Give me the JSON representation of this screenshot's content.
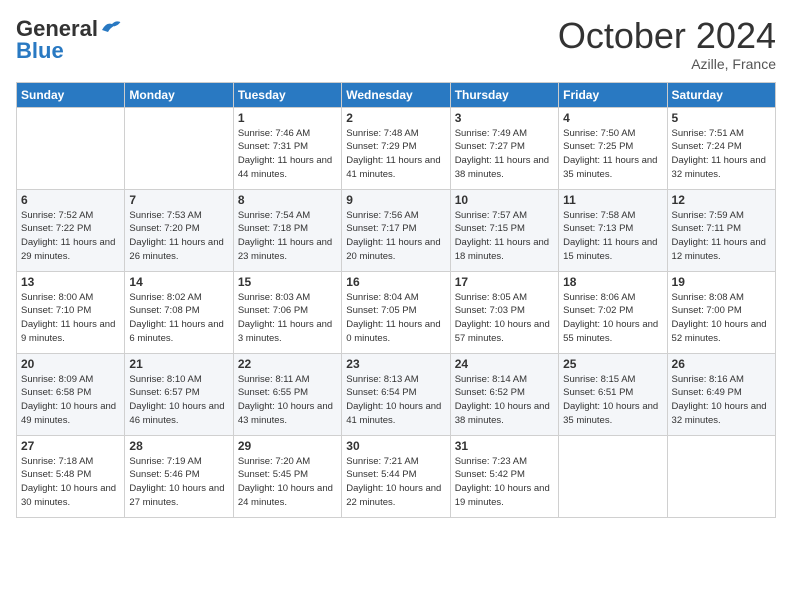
{
  "header": {
    "logo_general": "General",
    "logo_blue": "Blue",
    "month_title": "October 2024",
    "subtitle": "Azille, France"
  },
  "weekdays": [
    "Sunday",
    "Monday",
    "Tuesday",
    "Wednesday",
    "Thursday",
    "Friday",
    "Saturday"
  ],
  "weeks": [
    [
      {
        "day": "",
        "sunrise": "",
        "sunset": "",
        "daylight": ""
      },
      {
        "day": "",
        "sunrise": "",
        "sunset": "",
        "daylight": ""
      },
      {
        "day": "1",
        "sunrise": "Sunrise: 7:46 AM",
        "sunset": "Sunset: 7:31 PM",
        "daylight": "Daylight: 11 hours and 44 minutes."
      },
      {
        "day": "2",
        "sunrise": "Sunrise: 7:48 AM",
        "sunset": "Sunset: 7:29 PM",
        "daylight": "Daylight: 11 hours and 41 minutes."
      },
      {
        "day": "3",
        "sunrise": "Sunrise: 7:49 AM",
        "sunset": "Sunset: 7:27 PM",
        "daylight": "Daylight: 11 hours and 38 minutes."
      },
      {
        "day": "4",
        "sunrise": "Sunrise: 7:50 AM",
        "sunset": "Sunset: 7:25 PM",
        "daylight": "Daylight: 11 hours and 35 minutes."
      },
      {
        "day": "5",
        "sunrise": "Sunrise: 7:51 AM",
        "sunset": "Sunset: 7:24 PM",
        "daylight": "Daylight: 11 hours and 32 minutes."
      }
    ],
    [
      {
        "day": "6",
        "sunrise": "Sunrise: 7:52 AM",
        "sunset": "Sunset: 7:22 PM",
        "daylight": "Daylight: 11 hours and 29 minutes."
      },
      {
        "day": "7",
        "sunrise": "Sunrise: 7:53 AM",
        "sunset": "Sunset: 7:20 PM",
        "daylight": "Daylight: 11 hours and 26 minutes."
      },
      {
        "day": "8",
        "sunrise": "Sunrise: 7:54 AM",
        "sunset": "Sunset: 7:18 PM",
        "daylight": "Daylight: 11 hours and 23 minutes."
      },
      {
        "day": "9",
        "sunrise": "Sunrise: 7:56 AM",
        "sunset": "Sunset: 7:17 PM",
        "daylight": "Daylight: 11 hours and 20 minutes."
      },
      {
        "day": "10",
        "sunrise": "Sunrise: 7:57 AM",
        "sunset": "Sunset: 7:15 PM",
        "daylight": "Daylight: 11 hours and 18 minutes."
      },
      {
        "day": "11",
        "sunrise": "Sunrise: 7:58 AM",
        "sunset": "Sunset: 7:13 PM",
        "daylight": "Daylight: 11 hours and 15 minutes."
      },
      {
        "day": "12",
        "sunrise": "Sunrise: 7:59 AM",
        "sunset": "Sunset: 7:11 PM",
        "daylight": "Daylight: 11 hours and 12 minutes."
      }
    ],
    [
      {
        "day": "13",
        "sunrise": "Sunrise: 8:00 AM",
        "sunset": "Sunset: 7:10 PM",
        "daylight": "Daylight: 11 hours and 9 minutes."
      },
      {
        "day": "14",
        "sunrise": "Sunrise: 8:02 AM",
        "sunset": "Sunset: 7:08 PM",
        "daylight": "Daylight: 11 hours and 6 minutes."
      },
      {
        "day": "15",
        "sunrise": "Sunrise: 8:03 AM",
        "sunset": "Sunset: 7:06 PM",
        "daylight": "Daylight: 11 hours and 3 minutes."
      },
      {
        "day": "16",
        "sunrise": "Sunrise: 8:04 AM",
        "sunset": "Sunset: 7:05 PM",
        "daylight": "Daylight: 11 hours and 0 minutes."
      },
      {
        "day": "17",
        "sunrise": "Sunrise: 8:05 AM",
        "sunset": "Sunset: 7:03 PM",
        "daylight": "Daylight: 10 hours and 57 minutes."
      },
      {
        "day": "18",
        "sunrise": "Sunrise: 8:06 AM",
        "sunset": "Sunset: 7:02 PM",
        "daylight": "Daylight: 10 hours and 55 minutes."
      },
      {
        "day": "19",
        "sunrise": "Sunrise: 8:08 AM",
        "sunset": "Sunset: 7:00 PM",
        "daylight": "Daylight: 10 hours and 52 minutes."
      }
    ],
    [
      {
        "day": "20",
        "sunrise": "Sunrise: 8:09 AM",
        "sunset": "Sunset: 6:58 PM",
        "daylight": "Daylight: 10 hours and 49 minutes."
      },
      {
        "day": "21",
        "sunrise": "Sunrise: 8:10 AM",
        "sunset": "Sunset: 6:57 PM",
        "daylight": "Daylight: 10 hours and 46 minutes."
      },
      {
        "day": "22",
        "sunrise": "Sunrise: 8:11 AM",
        "sunset": "Sunset: 6:55 PM",
        "daylight": "Daylight: 10 hours and 43 minutes."
      },
      {
        "day": "23",
        "sunrise": "Sunrise: 8:13 AM",
        "sunset": "Sunset: 6:54 PM",
        "daylight": "Daylight: 10 hours and 41 minutes."
      },
      {
        "day": "24",
        "sunrise": "Sunrise: 8:14 AM",
        "sunset": "Sunset: 6:52 PM",
        "daylight": "Daylight: 10 hours and 38 minutes."
      },
      {
        "day": "25",
        "sunrise": "Sunrise: 8:15 AM",
        "sunset": "Sunset: 6:51 PM",
        "daylight": "Daylight: 10 hours and 35 minutes."
      },
      {
        "day": "26",
        "sunrise": "Sunrise: 8:16 AM",
        "sunset": "Sunset: 6:49 PM",
        "daylight": "Daylight: 10 hours and 32 minutes."
      }
    ],
    [
      {
        "day": "27",
        "sunrise": "Sunrise: 7:18 AM",
        "sunset": "Sunset: 5:48 PM",
        "daylight": "Daylight: 10 hours and 30 minutes."
      },
      {
        "day": "28",
        "sunrise": "Sunrise: 7:19 AM",
        "sunset": "Sunset: 5:46 PM",
        "daylight": "Daylight: 10 hours and 27 minutes."
      },
      {
        "day": "29",
        "sunrise": "Sunrise: 7:20 AM",
        "sunset": "Sunset: 5:45 PM",
        "daylight": "Daylight: 10 hours and 24 minutes."
      },
      {
        "day": "30",
        "sunrise": "Sunrise: 7:21 AM",
        "sunset": "Sunset: 5:44 PM",
        "daylight": "Daylight: 10 hours and 22 minutes."
      },
      {
        "day": "31",
        "sunrise": "Sunrise: 7:23 AM",
        "sunset": "Sunset: 5:42 PM",
        "daylight": "Daylight: 10 hours and 19 minutes."
      },
      {
        "day": "",
        "sunrise": "",
        "sunset": "",
        "daylight": ""
      },
      {
        "day": "",
        "sunrise": "",
        "sunset": "",
        "daylight": ""
      }
    ]
  ]
}
